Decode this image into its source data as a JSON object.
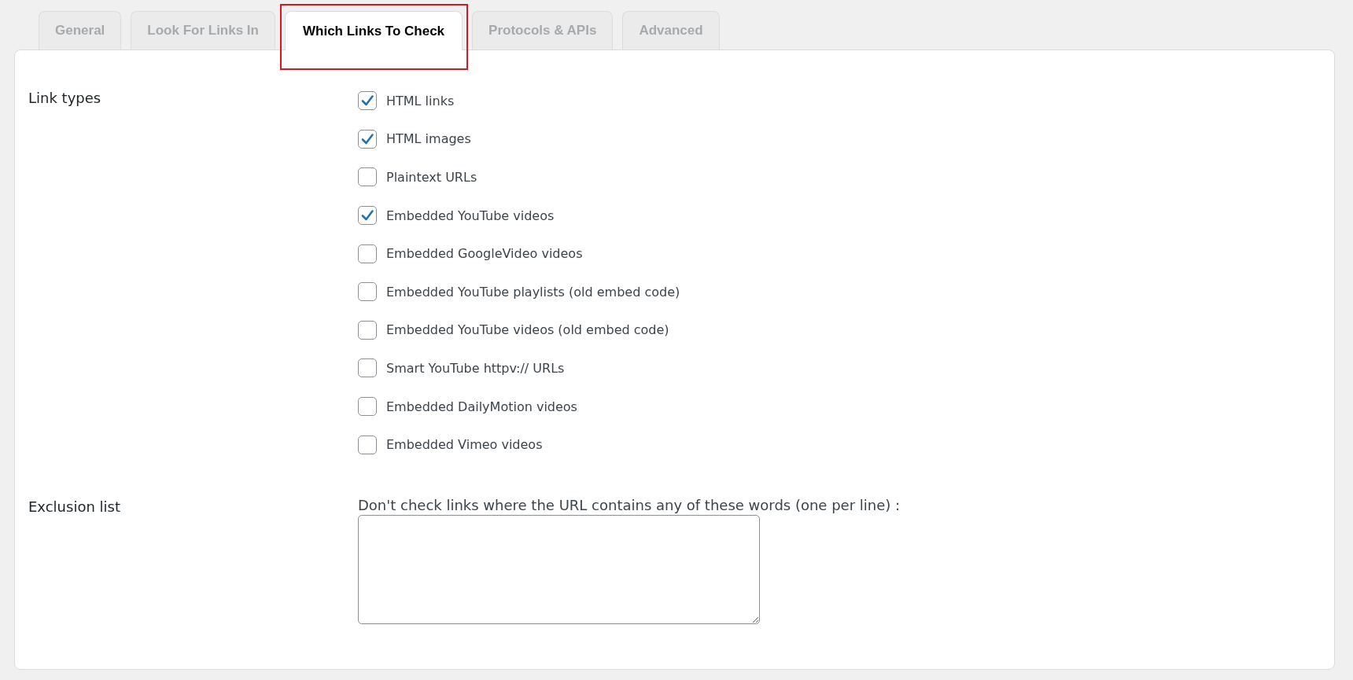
{
  "tabs": [
    {
      "label": "General",
      "selected": false,
      "highlighted": false
    },
    {
      "label": "Look For Links In",
      "selected": false,
      "highlighted": false
    },
    {
      "label": "Which Links To Check",
      "selected": true,
      "highlighted": true
    },
    {
      "label": "Protocols & APIs",
      "selected": false,
      "highlighted": false
    },
    {
      "label": "Advanced",
      "selected": false,
      "highlighted": false
    }
  ],
  "sections": [
    {
      "kind": "checklist",
      "label": "Link types",
      "options": [
        {
          "label": "HTML links",
          "checked": true
        },
        {
          "label": "HTML images",
          "checked": true
        },
        {
          "label": "Plaintext URLs",
          "checked": false
        },
        {
          "label": "Embedded YouTube videos",
          "checked": true
        },
        {
          "label": "Embedded GoogleVideo videos",
          "checked": false
        },
        {
          "label": "Embedded YouTube playlists (old embed code)",
          "checked": false
        },
        {
          "label": "Embedded YouTube videos (old embed code)",
          "checked": false
        },
        {
          "label": "Smart YouTube httpv:// URLs",
          "checked": false
        },
        {
          "label": "Embedded DailyMotion videos",
          "checked": false
        },
        {
          "label": "Embedded Vimeo videos",
          "checked": false
        }
      ]
    },
    {
      "kind": "textarea",
      "label": "Exclusion list",
      "description": "Don't check links where the URL contains any of these words (one per line) :"
    }
  ]
}
